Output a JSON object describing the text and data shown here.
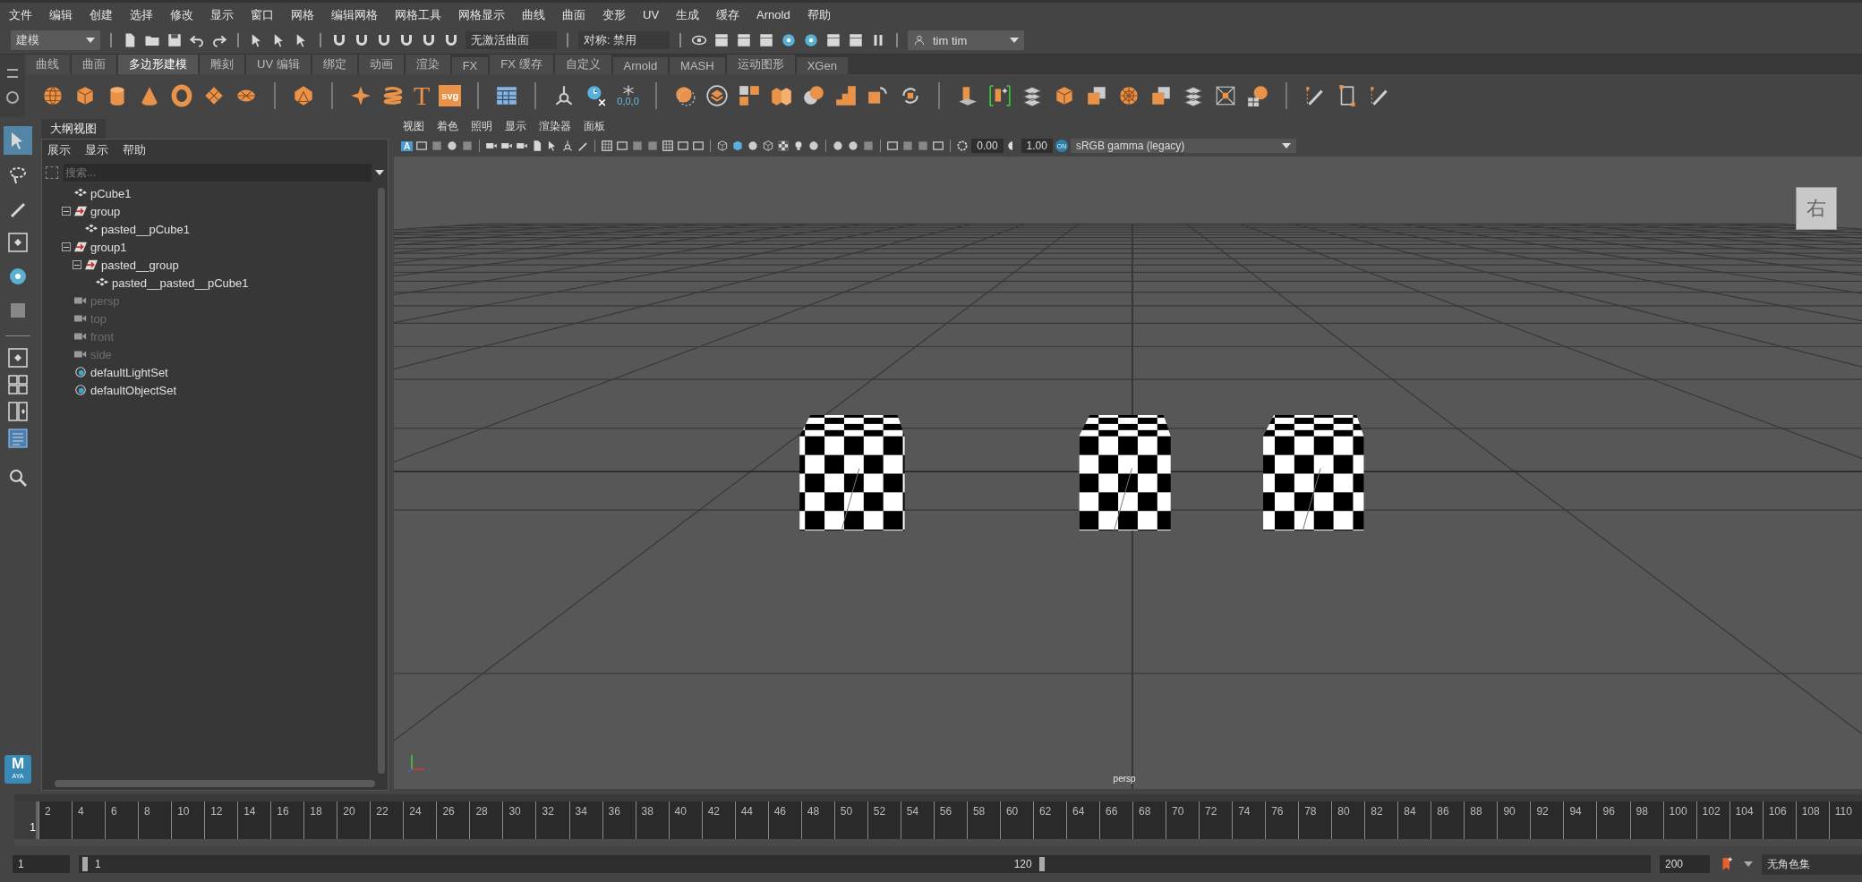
{
  "menu_bar": [
    "文件",
    "编辑",
    "创建",
    "选择",
    "修改",
    "显示",
    "窗口",
    "网格",
    "编辑网格",
    "网格工具",
    "网格显示",
    "曲线",
    "曲面",
    "变形",
    "UV",
    "生成",
    "缓存",
    "Arnold",
    "帮助"
  ],
  "status_line": {
    "mode": "建模",
    "live_surface": "无激活曲面",
    "symmetry": "对称: 禁用",
    "user": "tim tim"
  },
  "shelf_tabs": [
    {
      "label": "曲线",
      "selected": false
    },
    {
      "label": "曲面",
      "selected": false
    },
    {
      "label": "多边形建模",
      "selected": true
    },
    {
      "label": "雕刻",
      "selected": false
    },
    {
      "label": "UV 编辑",
      "selected": false
    },
    {
      "label": "绑定",
      "selected": false
    },
    {
      "label": "动画",
      "selected": false
    },
    {
      "label": "渲染",
      "selected": false
    },
    {
      "label": "FX",
      "selected": false
    },
    {
      "label": "FX 缓存",
      "selected": false
    },
    {
      "label": "自定义",
      "selected": false
    },
    {
      "label": "Arnold",
      "selected": false
    },
    {
      "label": "MASH",
      "selected": false
    },
    {
      "label": "运动图形",
      "selected": false
    },
    {
      "label": "XGen",
      "selected": false
    }
  ],
  "shelf": {
    "glyphs": [
      "T",
      "svg",
      "0,0,0"
    ]
  },
  "toolbox": [
    {
      "kind": "select",
      "selected": true
    },
    {
      "kind": "lasso",
      "selected": false
    },
    {
      "kind": "paint",
      "selected": false
    },
    {
      "kind": "move",
      "selected": false
    },
    {
      "kind": "rotate",
      "selected": false
    },
    {
      "kind": "scale",
      "selected": false
    }
  ],
  "logo": {
    "letter": "M",
    "caption": "AYA"
  },
  "outliner": {
    "title": "大纲视图",
    "menu": [
      "展示",
      "显示",
      "帮助"
    ],
    "search_placeholder": "搜索...",
    "items": [
      {
        "label": "pCube1",
        "kind": "mesh",
        "dimmed": false
      },
      {
        "label": "group",
        "kind": "group",
        "dimmed": false,
        "expanded": true,
        "children": [
          {
            "label": "pasted__pCube1",
            "kind": "mesh",
            "dimmed": false
          }
        ]
      },
      {
        "label": "group1",
        "kind": "group",
        "dimmed": false,
        "expanded": true,
        "children": [
          {
            "label": "pasted__group",
            "kind": "group",
            "dimmed": false,
            "expanded": true,
            "children": [
              {
                "label": "pasted__pasted__pCube1",
                "kind": "mesh",
                "dimmed": false
              }
            ]
          }
        ]
      },
      {
        "label": "persp",
        "kind": "camera",
        "dimmed": true
      },
      {
        "label": "top",
        "kind": "camera",
        "dimmed": true
      },
      {
        "label": "front",
        "kind": "camera",
        "dimmed": true
      },
      {
        "label": "side",
        "kind": "camera",
        "dimmed": true
      },
      {
        "label": "defaultLightSet",
        "kind": "set",
        "dimmed": false
      },
      {
        "label": "defaultObjectSet",
        "kind": "set",
        "dimmed": false
      }
    ]
  },
  "viewport": {
    "menu": [
      "视图",
      "着色",
      "照明",
      "显示",
      "渲染器",
      "面板"
    ],
    "toolbar_letter": "A",
    "exposure": "0.00",
    "gamma": "1.00",
    "color_space_badge": "ON",
    "color_space": "sRGB gamma (legacy)",
    "view_cube_label": "右",
    "camera_label": "persp"
  },
  "timeline": {
    "current_frame": "1",
    "level": 0,
    "ticks": [
      "2",
      "4",
      "6",
      "8",
      "10",
      "12",
      "14",
      "16",
      "18",
      "20",
      "22",
      "24",
      "26",
      "28",
      "30",
      "32",
      "34",
      "36",
      "38",
      "40",
      "42",
      "44",
      "46",
      "48",
      "50",
      "52",
      "54",
      "56",
      "58",
      "60",
      "62",
      "64",
      "66",
      "68",
      "70",
      "72",
      "74",
      "76",
      "78",
      "80",
      "82",
      "84",
      "86",
      "88",
      "90",
      "92",
      "94",
      "96",
      "98",
      "100",
      "102",
      "104",
      "106",
      "108",
      "110"
    ]
  },
  "range": {
    "start": "1",
    "range_start": "1",
    "range_end": "120",
    "level": 0.6,
    "end": "200",
    "character_set": "无角色集"
  }
}
